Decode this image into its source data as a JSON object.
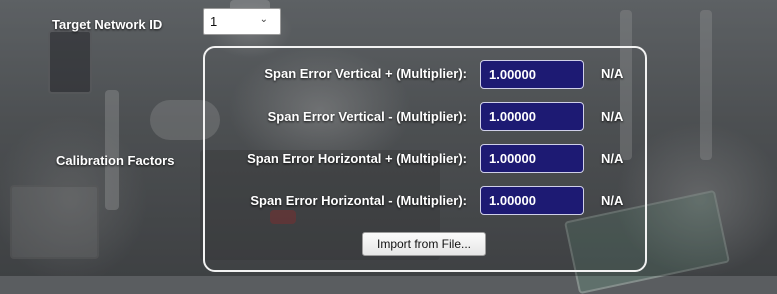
{
  "network": {
    "label": "Target Network ID",
    "selected": "1",
    "chevron_icon": "chevron-down-icon"
  },
  "calibration": {
    "section_label": "Calibration Factors",
    "rows": [
      {
        "label": "Span Error Vertical + (Multiplier):",
        "value": "1.00000",
        "status": "N/A"
      },
      {
        "label": "Span Error Vertical - (Multiplier):",
        "value": "1.00000",
        "status": "N/A"
      },
      {
        "label": "Span Error Horizontal + (Multiplier):",
        "value": "1.00000",
        "status": "N/A"
      },
      {
        "label": "Span Error Horizontal - (Multiplier):",
        "value": "1.00000",
        "status": "N/A"
      }
    ],
    "import_button": "Import from File..."
  },
  "colors": {
    "field_bg": "#1d1a73",
    "text": "#ffffff",
    "group_border": "#f2f2f2"
  }
}
